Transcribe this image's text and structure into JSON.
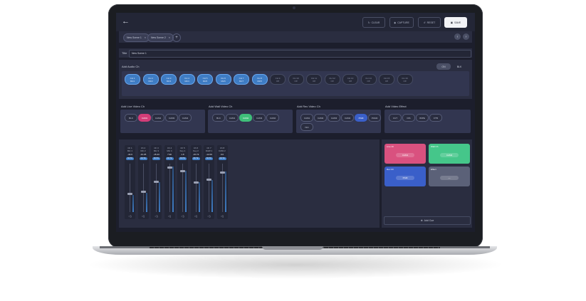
{
  "header": {
    "back_icon": "arrow-left-icon",
    "buttons": [
      {
        "label": "CLEAR",
        "icon": "refresh-icon"
      },
      {
        "label": "CAPTURE",
        "icon": "camera-icon"
      },
      {
        "label": "RESET",
        "icon": "reset-icon"
      },
      {
        "label": "SAVE",
        "icon": "save-icon"
      }
    ]
  },
  "tabs": [
    {
      "label": "New Scene 1",
      "close": "×"
    },
    {
      "label": "New Scene 2",
      "close": "×"
    }
  ],
  "tab_add": "+",
  "nav": {
    "prev": "‹",
    "next": "›"
  },
  "title_field": {
    "label": "Title",
    "value": "New Scene 1"
  },
  "audio": {
    "heading": "Add Audio Ch",
    "toggle": [
      "ON",
      "BLK"
    ],
    "channels": [
      {
        "name": "CH 1",
        "sub": "Mic1",
        "on": true
      },
      {
        "name": "CH 2",
        "sub": "Mic2",
        "on": true
      },
      {
        "name": "CH 3",
        "sub": "Mic3",
        "on": true
      },
      {
        "name": "CH 4",
        "sub": "Mic4",
        "on": true
      },
      {
        "name": "CH 5",
        "sub": "Mic5",
        "on": true
      },
      {
        "name": "CH 6",
        "sub": "Mic6",
        "on": true
      },
      {
        "name": "CH 7",
        "sub": "Mic7",
        "on": true
      },
      {
        "name": "CH 8",
        "sub": "Mic8",
        "on": true
      },
      {
        "name": "CH 9",
        "sub": "Off",
        "on": false
      },
      {
        "name": "CH 10",
        "sub": "Off",
        "on": false
      },
      {
        "name": "CH 11",
        "sub": "Off",
        "on": false
      },
      {
        "name": "CH 12",
        "sub": "Off",
        "on": false
      },
      {
        "name": "CH 13",
        "sub": "Off",
        "on": false
      },
      {
        "name": "CH 14",
        "sub": "Off",
        "on": false
      },
      {
        "name": "CH 15",
        "sub": "Off",
        "on": false
      },
      {
        "name": "CH 16",
        "sub": "Off",
        "on": false
      }
    ]
  },
  "live_video": {
    "heading": "Add Live Video Ch",
    "chips": [
      "BLK",
      "CAM1",
      "CAM2",
      "CAM3",
      "CAM4"
    ],
    "active": 1,
    "color": "#d23d78"
  },
  "wall_video": {
    "heading": "Add Wall Video Ch",
    "chips": [
      "BLK",
      "CAM1",
      "CAM2",
      "CAM3",
      "CAM4"
    ],
    "active": 2,
    "color": "#3fbf7a"
  },
  "rec_video": {
    "heading": "Add Rec Video Ch",
    "chips": [
      "CAM1",
      "CAM2",
      "CAM3",
      "CAM4",
      "PGM",
      "PGM2",
      "ISO"
    ],
    "active": 4,
    "color": "#3a5fc9"
  },
  "video_effect": {
    "heading": "Add Video Effect",
    "chips": [
      "CUT",
      "DIS",
      "WIPE",
      "FTB"
    ]
  },
  "mixer": {
    "strips": [
      {
        "name": "Ch 1",
        "sub": "Mic 1",
        "val": "-34.6"
      },
      {
        "name": "Ch 2",
        "sub": "Mic 2",
        "val": "-31.25"
      },
      {
        "name": "Ch 3",
        "sub": "Mic 3",
        "val": "-15.43"
      },
      {
        "name": "Ch 4",
        "sub": "Mic 4",
        "val": "7.90"
      },
      {
        "name": "Ch 5",
        "sub": "Key 1",
        "val": "1.8"
      },
      {
        "name": "Ch 6",
        "sub": "Key 2",
        "val": "-15.73"
      },
      {
        "name": "Ch 7",
        "sub": "DAW 1",
        "val": "-12.09"
      },
      {
        "name": "Ch 8",
        "sub": "DAW 2",
        "val": "0.0"
      }
    ],
    "mute_label": "MUTE"
  },
  "cards": [
    {
      "label": "Live Ch",
      "state": "CAM1",
      "color": "#d9517f"
    },
    {
      "label": "Wall Ch",
      "state": "CAM2",
      "color": "#45c68a"
    },
    {
      "label": "Rec Ch",
      "state": "PGM",
      "color": "#3a5fc9"
    },
    {
      "label": "Effect",
      "state": "—",
      "color": "#5b6178"
    }
  ],
  "cue_button": {
    "label": "Add Cue",
    "icon": "plus-icon"
  }
}
